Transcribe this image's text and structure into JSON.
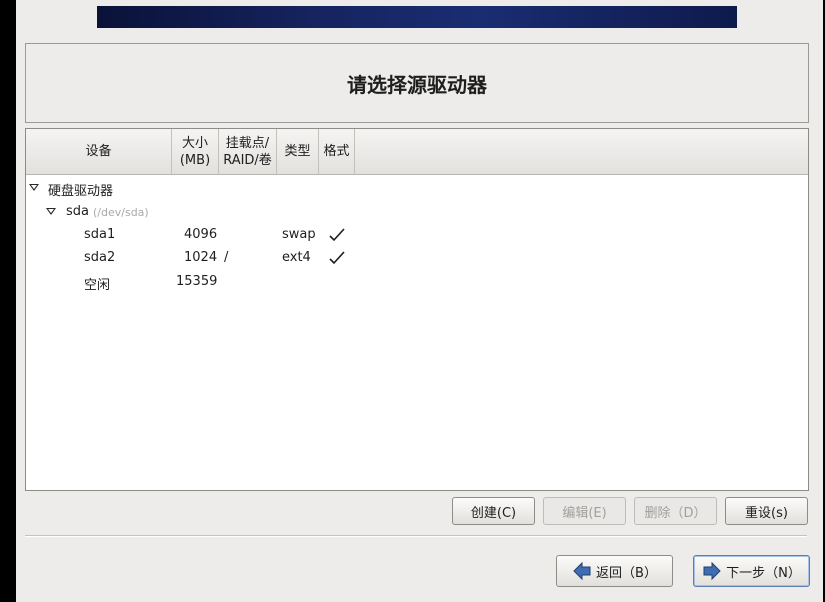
{
  "header": {
    "title": "请选择源驱动器"
  },
  "columns": {
    "device": "设备",
    "size_line1": "大小",
    "size_line2": "(MB)",
    "mount_line1": "挂载点/",
    "mount_line2": "RAID/卷",
    "type": "类型",
    "format": "格式"
  },
  "tree": {
    "group": {
      "label": "硬盘驱动器",
      "expanded": true
    },
    "disk": {
      "name": "sda",
      "path": "(/dev/sda)",
      "expanded": true
    },
    "partitions": [
      {
        "device": "sda1",
        "size": "4096",
        "mount": "",
        "type": "swap",
        "format": true
      },
      {
        "device": "sda2",
        "size": "1024",
        "mount": "/",
        "type": "ext4",
        "format": true
      },
      {
        "device": "空闲",
        "size": "15359",
        "mount": "",
        "type": "",
        "format": false
      }
    ]
  },
  "actions": {
    "create": "创建(C)",
    "edit": "编辑(E)",
    "delete": "删除（D）",
    "reset": "重设(s)"
  },
  "nav": {
    "back": "返回（B）",
    "next": "下一步（N）"
  },
  "colors": {
    "banner": "#162460",
    "background": "#edeceb",
    "arrow_icon": "#3f6db3"
  }
}
